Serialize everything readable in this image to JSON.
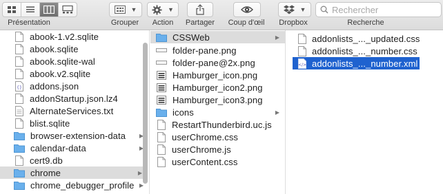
{
  "toolbar": {
    "presentation_label": "Présentation",
    "group_label": "Grouper",
    "action_label": "Action",
    "share_label": "Partager",
    "quicklook_label": "Coup d'œil",
    "dropbox_label": "Dropbox",
    "search_label": "Recherche",
    "search_placeholder": "Rechercher"
  },
  "column1": {
    "items": [
      {
        "name": "abook-1.v2.sqlite",
        "icon": "document-icon"
      },
      {
        "name": "abook.sqlite",
        "icon": "document-icon"
      },
      {
        "name": "abook.sqlite-wal",
        "icon": "document-icon"
      },
      {
        "name": "abook.v2.sqlite",
        "icon": "document-icon"
      },
      {
        "name": "addons.json",
        "icon": "json-file-icon"
      },
      {
        "name": "addonStartup.json.lz4",
        "icon": "document-icon"
      },
      {
        "name": "AlternateServices.txt",
        "icon": "text-file-icon"
      },
      {
        "name": "blist.sqlite",
        "icon": "document-icon"
      },
      {
        "name": "browser-extension-data",
        "icon": "folder-icon"
      },
      {
        "name": "calendar-data",
        "icon": "folder-icon"
      },
      {
        "name": "cert9.db",
        "icon": "document-icon"
      },
      {
        "name": "chrome",
        "icon": "folder-icon"
      },
      {
        "name": "chrome_debugger_profile",
        "icon": "folder-icon"
      }
    ]
  },
  "column2": {
    "items": [
      {
        "name": "CSSWeb",
        "icon": "folder-icon"
      },
      {
        "name": "folder-pane.png",
        "icon": "image-file-icon"
      },
      {
        "name": "folder-pane@2x.png",
        "icon": "image-file-icon"
      },
      {
        "name": "Hamburger_icon.png",
        "icon": "hamburger-image-icon"
      },
      {
        "name": "Hamburger_icon2.png",
        "icon": "hamburger-image-icon"
      },
      {
        "name": "Hamburger_icon3.png",
        "icon": "hamburger-image-icon"
      },
      {
        "name": "icons",
        "icon": "folder-icon"
      },
      {
        "name": "RestartThunderbird.uc.js",
        "icon": "document-icon"
      },
      {
        "name": "userChrome.css",
        "icon": "document-icon"
      },
      {
        "name": "userChrome.js",
        "icon": "document-icon"
      },
      {
        "name": "userContent.css",
        "icon": "document-icon"
      }
    ]
  },
  "column3": {
    "items": [
      {
        "name": "addonlists_..._updated.css",
        "icon": "document-icon"
      },
      {
        "name": "addonlists_..._number.css",
        "icon": "document-icon"
      },
      {
        "name": "addonlists_..._number.xml",
        "icon": "xml-file-icon"
      }
    ]
  },
  "colors": {
    "selection_blue": "#1f62cf",
    "selection_gray": "#dcdcdc",
    "folder_blue": "#6ab0ec"
  }
}
